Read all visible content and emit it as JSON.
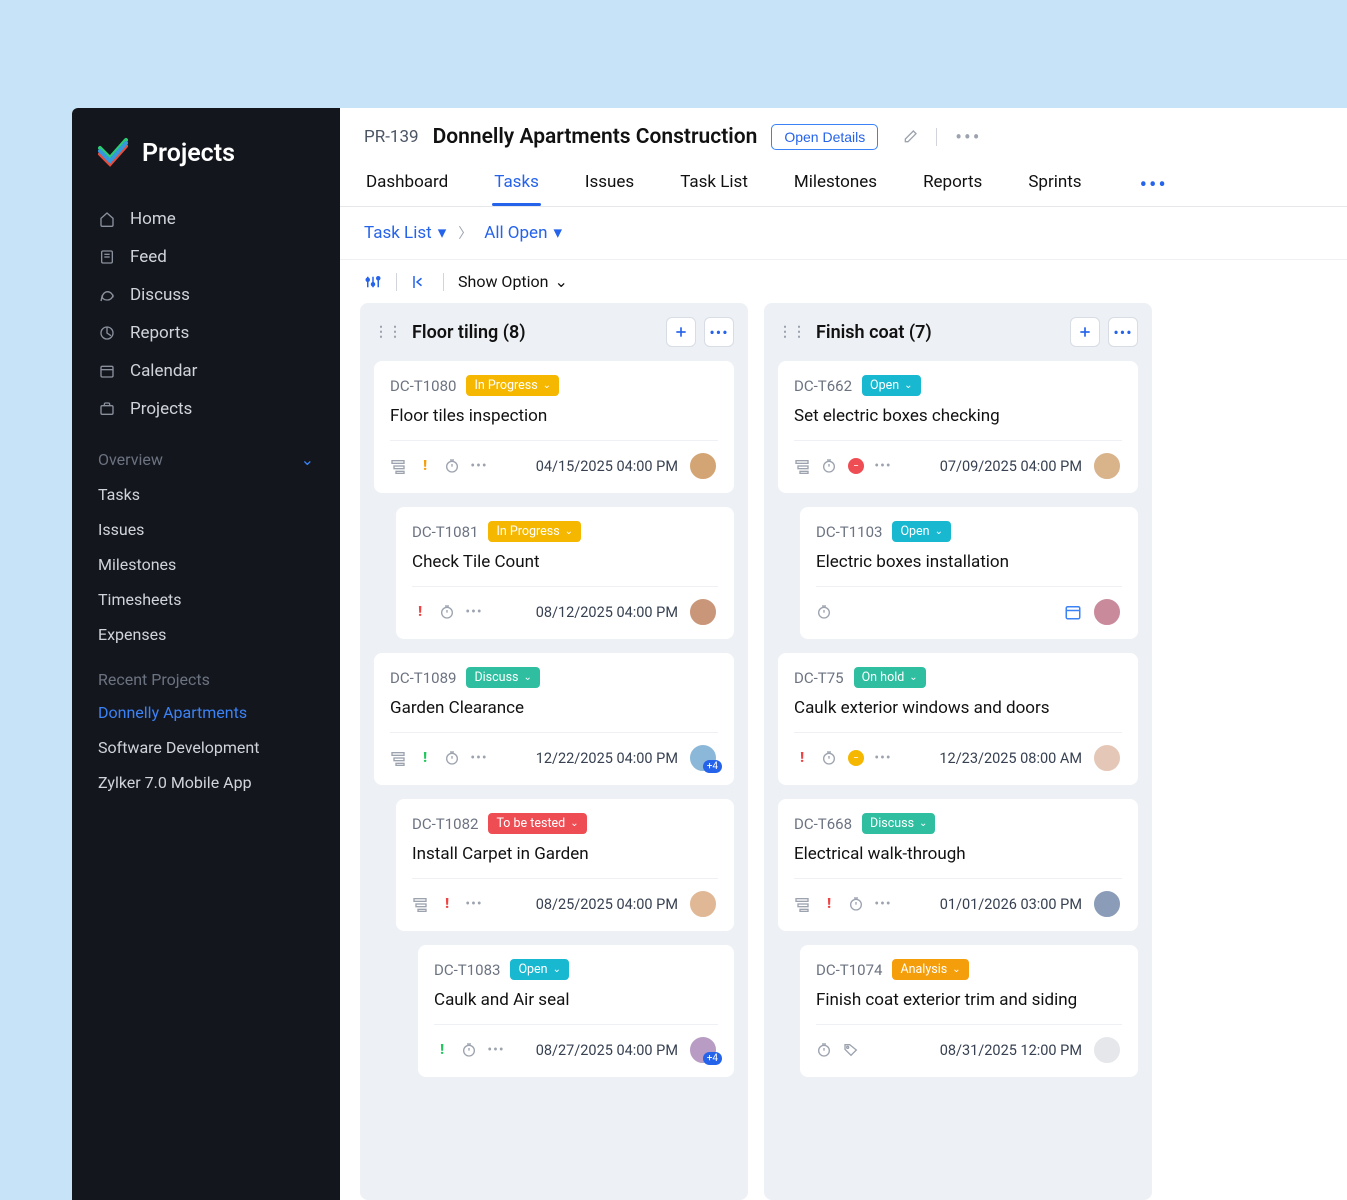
{
  "app_name": "Projects",
  "sidebar": {
    "nav": [
      {
        "label": "Home"
      },
      {
        "label": "Feed"
      },
      {
        "label": "Discuss"
      },
      {
        "label": "Reports"
      },
      {
        "label": "Calendar"
      },
      {
        "label": "Projects"
      }
    ],
    "overview_label": "Overview",
    "overview_items": [
      {
        "label": "Tasks"
      },
      {
        "label": "Issues"
      },
      {
        "label": "Milestones"
      },
      {
        "label": "Timesheets"
      },
      {
        "label": "Expenses"
      }
    ],
    "recent_label": "Recent Projects",
    "recent_items": [
      {
        "label": "Donnelly Apartments",
        "active": true
      },
      {
        "label": "Software Development"
      },
      {
        "label": "Zylker 7.0 Mobile App"
      }
    ]
  },
  "header": {
    "project_id": "PR-139",
    "project_title": "Donnelly Apartments Construction",
    "open_details": "Open Details",
    "tabs": [
      "Dashboard",
      "Tasks",
      "Issues",
      "Task List",
      "Milestones",
      "Reports",
      "Sprints"
    ],
    "active_tab": 1
  },
  "breadcrumb": {
    "task_list": "Task List",
    "all_open": "All Open"
  },
  "toolbar": {
    "show_option": "Show Option"
  },
  "columns": [
    {
      "title": "Floor tiling",
      "count": 8,
      "cards": [
        {
          "id": "DC-T1080",
          "status": "In Progress",
          "status_color": "yellow",
          "title": "Floor tiles inspection",
          "date": "04/15/2025 04:00 PM",
          "indent": 0,
          "subtask": true,
          "priority": "yellow",
          "timer": true,
          "more": true,
          "avatar": "a1"
        },
        {
          "id": "DC-T1081",
          "status": "In Progress",
          "status_color": "yellow",
          "title": "Check Tile Count",
          "date": "08/12/2025 04:00 PM",
          "indent": 1,
          "subtask": false,
          "priority": "red",
          "timer": true,
          "more": true,
          "avatar": "a2"
        },
        {
          "id": "DC-T1089",
          "status": "Discuss",
          "status_color": "teal",
          "title": "Garden Clearance",
          "date": "12/22/2025 04:00 PM",
          "indent": 0,
          "subtask": true,
          "priority": "green",
          "timer": true,
          "more": true,
          "avatar": "a3",
          "extra_count": "+4"
        },
        {
          "id": "DC-T1082",
          "status": "To be tested",
          "status_color": "red",
          "title": "Install Carpet in Garden",
          "date": "08/25/2025 04:00 PM",
          "indent": 1,
          "subtask": true,
          "priority": "red",
          "timer": false,
          "more": true,
          "avatar": "a4"
        },
        {
          "id": "DC-T1083",
          "status": "Open",
          "status_color": "cyan",
          "title": "Caulk and Air seal",
          "date": "08/27/2025 04:00 PM",
          "indent": 2,
          "subtask": false,
          "priority": "green",
          "timer": true,
          "more": true,
          "avatar": "a5",
          "extra_count": "+4"
        }
      ]
    },
    {
      "title": "Finish coat",
      "count": 7,
      "cards": [
        {
          "id": "DC-T662",
          "status": "Open",
          "status_color": "cyan",
          "title": "Set electric boxes checking",
          "date": "07/09/2025 04:00 PM",
          "indent": 0,
          "subtask": true,
          "timer": true,
          "dot": "red",
          "more": true,
          "avatar": "b1"
        },
        {
          "id": "DC-T1103",
          "status": "Open",
          "status_color": "cyan",
          "title": "Electric boxes installation",
          "date": "",
          "indent": 1,
          "subtask": false,
          "timer": true,
          "more": false,
          "avatar": "b2",
          "calendar": true
        },
        {
          "id": "DC-T75",
          "status": "On hold",
          "status_color": "teal",
          "title": "Caulk exterior windows and doors",
          "date": "12/23/2025 08:00 AM",
          "indent": 0,
          "subtask": false,
          "priority": "red",
          "timer": true,
          "dot": "yellow",
          "more": true,
          "avatar": "b3"
        },
        {
          "id": "DC-T668",
          "status": "Discuss",
          "status_color": "teal",
          "title": "Electrical walk-through",
          "date": "01/01/2026 03:00 PM",
          "indent": 0,
          "subtask": true,
          "priority": "red",
          "timer": true,
          "more": true,
          "avatar": "b4"
        },
        {
          "id": "DC-T1074",
          "status": "Analysis",
          "status_color": "orange",
          "title": "Finish coat exterior trim and siding",
          "date": "08/31/2025 12:00 PM",
          "indent": 1,
          "subtask": false,
          "timer": true,
          "tag": true,
          "more": false,
          "avatar": "placeholder"
        }
      ]
    }
  ]
}
